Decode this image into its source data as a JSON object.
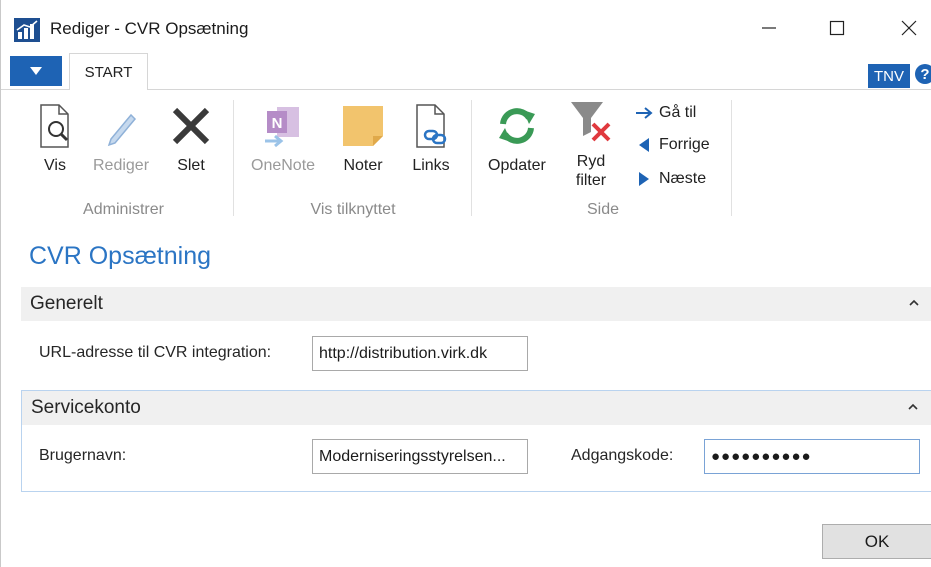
{
  "window": {
    "title": "Rediger - CVR Opsætning"
  },
  "ribbon": {
    "tab_start": "START",
    "user_badge": "TNV",
    "groups": {
      "administrer": "Administrer",
      "vis_tilknyttet": "Vis tilknyttet",
      "side": "Side"
    },
    "buttons": {
      "vis": "Vis",
      "rediger": "Rediger",
      "slet": "Slet",
      "onenote": "OneNote",
      "noter": "Noter",
      "links": "Links",
      "opdater": "Opdater",
      "ryd_filter_line1": "Ryd",
      "ryd_filter_line2": "filter",
      "gaa_til": "Gå til",
      "forrige": "Forrige",
      "naeste": "Næste"
    }
  },
  "page": {
    "title": "CVR Opsætning",
    "generelt": {
      "title": "Generelt",
      "url_label": "URL-adresse til CVR integration:",
      "url_value": "http://distribution.virk.dk"
    },
    "servicekonto": {
      "title": "Servicekonto",
      "username_label": "Brugernavn:",
      "username_value": "Moderniseringsstyrelsen...",
      "password_label": "Adgangskode:",
      "password_value": "●●●●●●●●●●"
    },
    "ok_label": "OK"
  },
  "colors": {
    "accent_blue": "#1e63b4",
    "page_title_blue": "#2b75c4",
    "refresh_green": "#3a9a56",
    "delete_red": "#e0393e",
    "note_yellow": "#f2c46d",
    "onenote_purple": "#b58cc7"
  }
}
